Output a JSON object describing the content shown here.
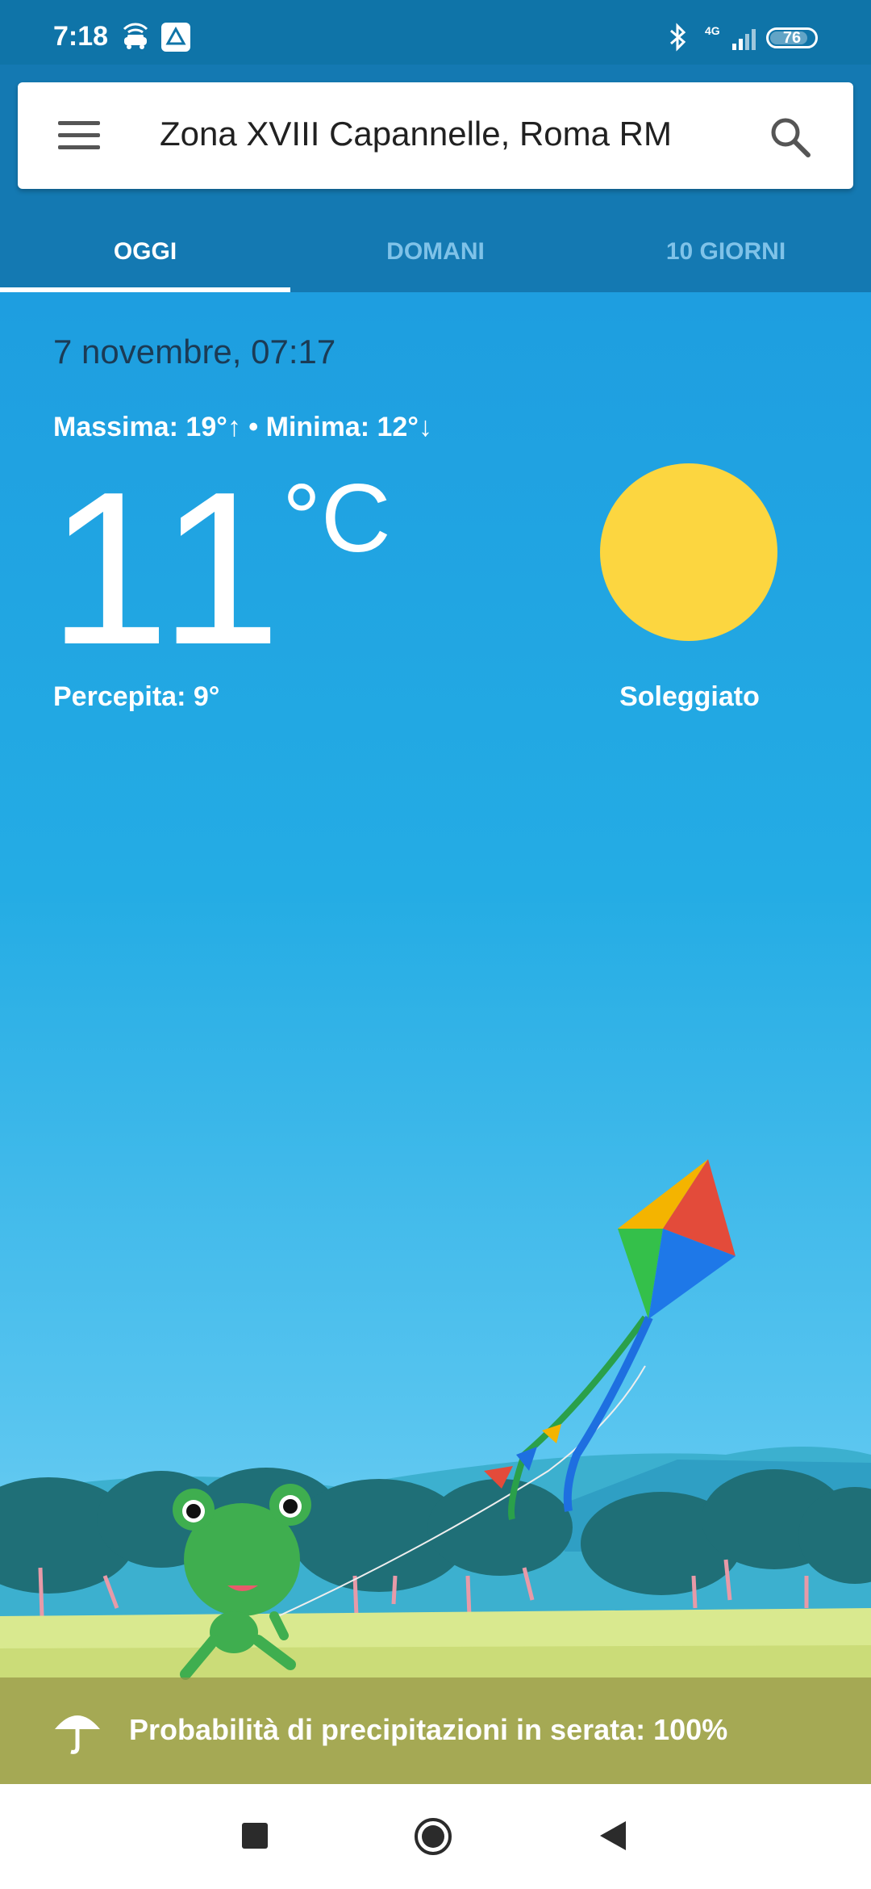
{
  "status_bar": {
    "time": "7:18",
    "network": "4G",
    "battery": "76"
  },
  "search": {
    "location": "Zona XVIII Capannelle, Roma RM"
  },
  "tabs": [
    {
      "label": "OGGI",
      "active": true
    },
    {
      "label": "DOMANI",
      "active": false
    },
    {
      "label": "10 GIORNI",
      "active": false
    }
  ],
  "weather": {
    "date": "7 novembre, 07:17",
    "max_min": "Massima: 19°↑ • Minima: 12°↓",
    "temperature": "11",
    "unit": "°C",
    "feels_like": "Percepita: 9°",
    "condition": "Soleggiato"
  },
  "rain": {
    "text": "Probabilità di precipitazioni in serata: 100%"
  },
  "colors": {
    "header": "#1479b2",
    "sky": "#1e9ee0",
    "sun": "#fcd640"
  },
  "icons": [
    "menu-icon",
    "search-icon",
    "sun-icon",
    "umbrella-icon",
    "kite-illustration",
    "frog-illustration"
  ]
}
